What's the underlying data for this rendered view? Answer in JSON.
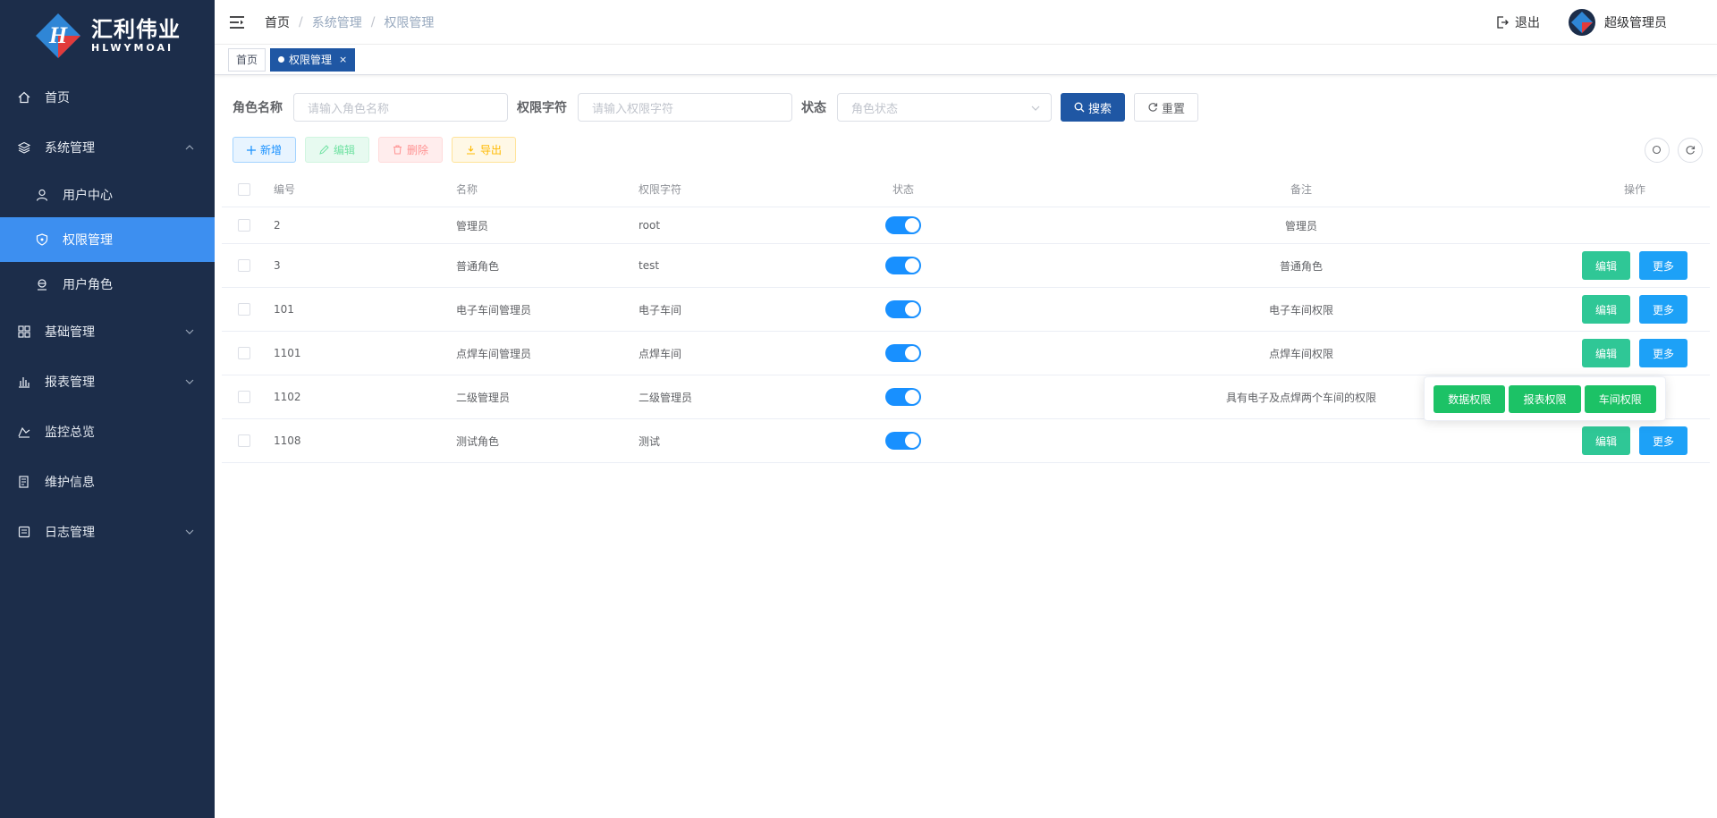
{
  "brand": {
    "name_cn": "汇利伟业",
    "name_en": "HLWYMOAI",
    "colors": {
      "sidebar": "#1c2d4a",
      "active": "#3d8ff0",
      "primary": "#1f57a4"
    }
  },
  "sidebar": {
    "items": [
      {
        "label": "首页",
        "icon": "home-icon"
      },
      {
        "label": "系统管理",
        "icon": "layers-icon",
        "expanded": true
      },
      {
        "label": "用户中心",
        "icon": "user-icon"
      },
      {
        "label": "权限管理",
        "icon": "shield-icon",
        "active": true
      },
      {
        "label": "用户角色",
        "icon": "role-icon"
      },
      {
        "label": "基础管理",
        "icon": "grid-icon"
      },
      {
        "label": "报表管理",
        "icon": "chart-icon"
      },
      {
        "label": "监控总览",
        "icon": "monitor-icon"
      },
      {
        "label": "维护信息",
        "icon": "doc-icon"
      },
      {
        "label": "日志管理",
        "icon": "log-icon"
      }
    ]
  },
  "header": {
    "breadcrumb": [
      "首页",
      "系统管理",
      "权限管理"
    ],
    "separator": "/",
    "logout": "退出",
    "username": "超级管理员"
  },
  "tags": {
    "home": "首页",
    "current": "权限管理",
    "close": "×"
  },
  "search": {
    "role_name_label": "角色名称",
    "role_name_placeholder": "请输入角色名称",
    "role_key_label": "权限字符",
    "role_key_placeholder": "请输入权限字符",
    "status_label": "状态",
    "status_placeholder": "角色状态",
    "search_btn": "搜索",
    "reset_btn": "重置"
  },
  "toolbar": {
    "add": "新增",
    "edit": "编辑",
    "delete": "删除",
    "export": "导出"
  },
  "table": {
    "headers": {
      "id": "编号",
      "name": "名称",
      "key": "权限字符",
      "status": "状态",
      "remark": "备注",
      "ops": "操作"
    },
    "rows": [
      {
        "id": "2",
        "name": "管理员",
        "key": "root",
        "status": true,
        "remark": "管理员",
        "actions": false
      },
      {
        "id": "3",
        "name": "普通角色",
        "key": "test",
        "status": true,
        "remark": "普通角色",
        "actions": true
      },
      {
        "id": "101",
        "name": "电子车间管理员",
        "key": "电子车间",
        "status": true,
        "remark": "电子车间权限",
        "actions": true
      },
      {
        "id": "1101",
        "name": "点焊车间管理员",
        "key": "点焊车间",
        "status": true,
        "remark": "点焊车间权限",
        "actions": true
      },
      {
        "id": "1102",
        "name": "二级管理员",
        "key": "二级管理员",
        "status": true,
        "remark": "具有电子及点焊两个车间的权限",
        "actions": false
      },
      {
        "id": "1108",
        "name": "测试角色",
        "key": "测试",
        "status": true,
        "remark": "",
        "actions": true
      }
    ],
    "edit_btn": "编辑",
    "more_btn": "更多"
  },
  "popover": {
    "data_perm": "数据权限",
    "report_perm": "报表权限",
    "workshop_perm": "车间权限"
  }
}
